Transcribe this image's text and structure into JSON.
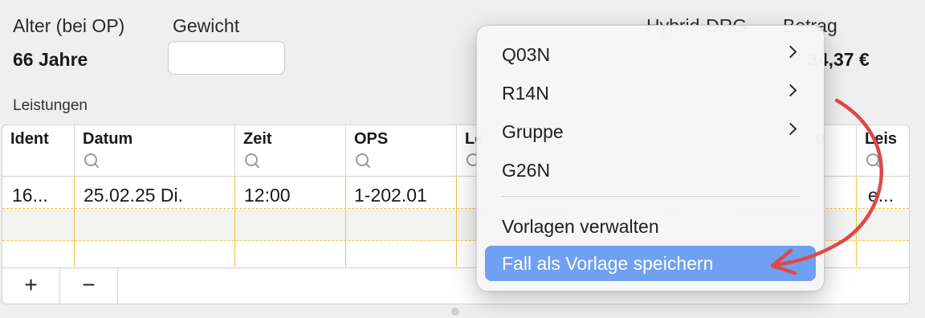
{
  "header": {
    "age_label": "Alter (bei OP)",
    "age_value": "66 Jahre",
    "weight_label": "Gewicht",
    "weight_value": "",
    "hybrid_label": "Hybrid-DRG",
    "amount_label": "Betrag",
    "amount_value": "34,37 €"
  },
  "services": {
    "section_label": "Leistungen",
    "columns": [
      "Ident",
      "Datum",
      "Zeit",
      "OPS",
      "Le",
      "u",
      "Leis"
    ],
    "rows": [
      {
        "ident": "16...",
        "datum": "25.02.25 Di.",
        "zeit": "12:00",
        "ops": "1-202.01",
        "c7": "e..."
      }
    ],
    "add_label": "+",
    "remove_label": "−"
  },
  "context_menu": {
    "items": [
      {
        "label": "Q03N",
        "has_submenu": true
      },
      {
        "label": "R14N",
        "has_submenu": true
      },
      {
        "label": "Gruppe",
        "has_submenu": true
      },
      {
        "label": "G26N",
        "has_submenu": false
      },
      {
        "label": "Vorlagen verwalten",
        "has_submenu": false
      },
      {
        "label": "Fall als Vorlage speichern",
        "has_submenu": false,
        "highlighted": true
      }
    ]
  },
  "colors": {
    "highlight": "#6fa0f2",
    "arrow": "#e04848",
    "row_divider": "#f0c440"
  }
}
